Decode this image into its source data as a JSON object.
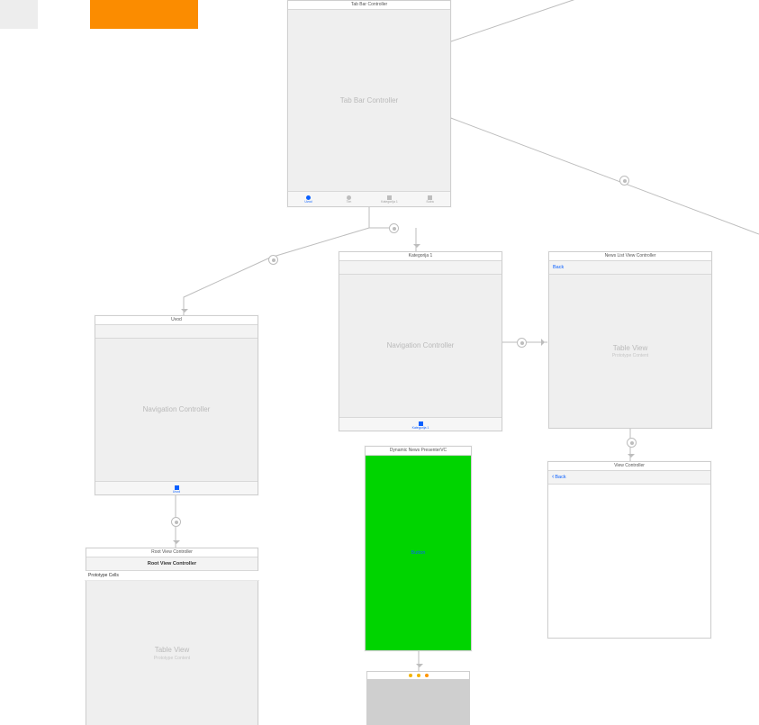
{
  "swatches": {
    "grey": "#ededed",
    "orange": "#fb8c00"
  },
  "tabbar_scene": {
    "title": "Tab Bar Controller",
    "body_label": "Tab Bar Controller",
    "tabs": [
      {
        "label": "Uvod",
        "selected": true
      },
      {
        "label": "Tim",
        "selected": false
      },
      {
        "label": "Kategorija 1",
        "selected": false
      },
      {
        "label": "Sutra",
        "selected": false
      }
    ]
  },
  "nav_uvod": {
    "title": "Uvod",
    "body_label": "Navigation Controller",
    "tab_label": "Uvod"
  },
  "nav_kategorija": {
    "title": "Kategorija 1",
    "body_label": "Navigation Controller",
    "tab_label": "Kategorija 1"
  },
  "news_list": {
    "title": "News List View Controller",
    "back_label": "Back",
    "body_label": "Table View",
    "body_sub": "Prototype Content"
  },
  "root_view": {
    "title": "Root View Controller",
    "nav_title": "Root View Controller",
    "proto_label": "Prototype Cells",
    "body_label": "Table View",
    "body_sub": "Prototype Content"
  },
  "dynamic_presenter": {
    "title": "Dynamic News PresenterVC",
    "button_label": "Button"
  },
  "view_controller": {
    "title": "View Controller",
    "back_label": "Back"
  },
  "dockstrip": {
    "dot_colors": [
      "#f3b400",
      "#f3b400",
      "#ff9500"
    ]
  }
}
